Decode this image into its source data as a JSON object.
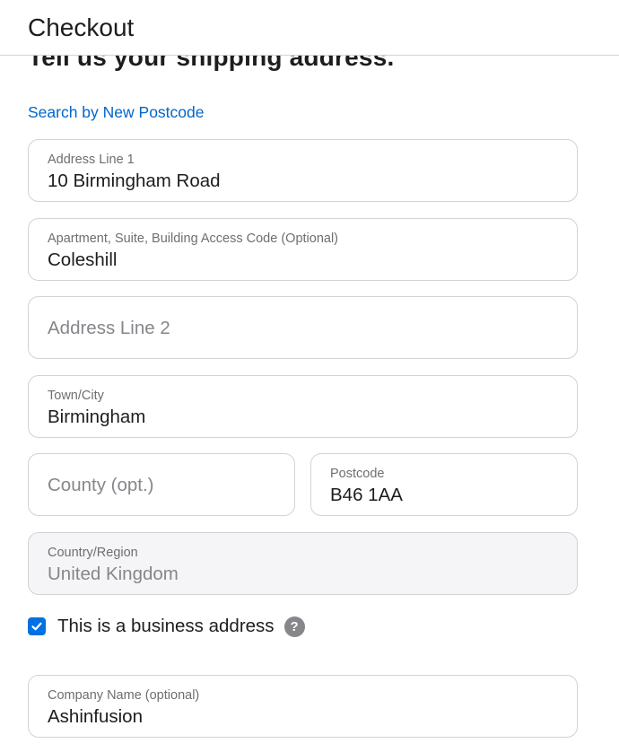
{
  "header": {
    "title": "Checkout"
  },
  "section": {
    "heading": "Tell us your shipping address."
  },
  "search_link": "Search by New Postcode",
  "fields": {
    "address_line_1": {
      "label": "Address Line 1",
      "value": "10 Birmingham Road"
    },
    "apartment": {
      "label": "Apartment, Suite, Building Access Code (Optional)",
      "value": "Coleshill"
    },
    "address_line_2": {
      "placeholder": "Address Line 2"
    },
    "town_city": {
      "label": "Town/City",
      "value": "Birmingham"
    },
    "county": {
      "placeholder": "County (opt.)"
    },
    "postcode": {
      "label": "Postcode",
      "value": "B46 1AA"
    },
    "country": {
      "label": "Country/Region",
      "value": "United Kingdom"
    },
    "company": {
      "label": "Company Name (optional)",
      "value": "Ashinfusion"
    }
  },
  "business_address": {
    "label": "This is a business address",
    "checked": true,
    "help_icon": "?"
  },
  "colors": {
    "accent": "#0071e3",
    "link": "#0066cc",
    "border": "#d2d2d7"
  },
  "icons": {
    "checkbox": "checkmark-icon",
    "help": "question-mark-icon"
  }
}
